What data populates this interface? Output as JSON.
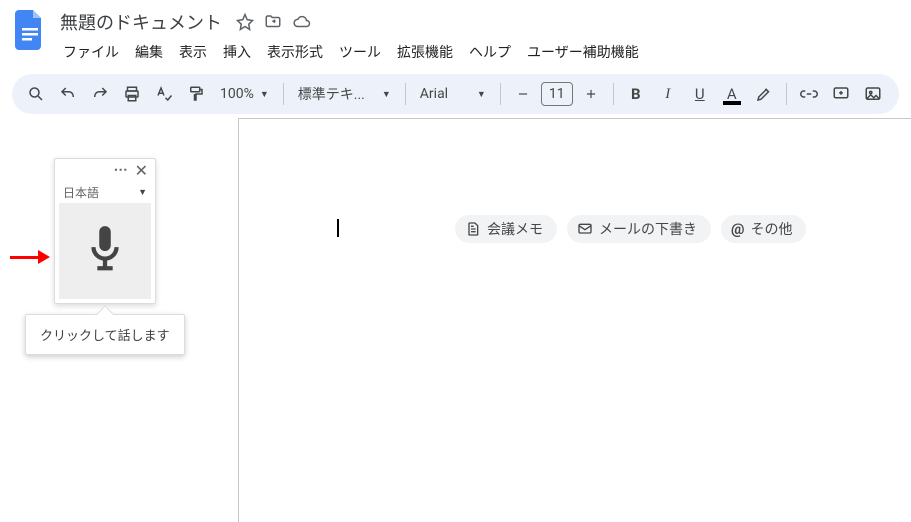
{
  "header": {
    "title": "無題のドキュメント",
    "icons": {
      "star": "star-icon",
      "move": "folder-move-icon",
      "cloud": "cloud-saved-icon"
    }
  },
  "menubar": {
    "items": [
      "ファイル",
      "編集",
      "表示",
      "挿入",
      "表示形式",
      "ツール",
      "拡張機能",
      "ヘルプ",
      "ユーザー補助機能"
    ]
  },
  "toolbar": {
    "zoom": "100%",
    "styles_label": "標準テキ...",
    "font": "Arial",
    "font_size": "11"
  },
  "chips": {
    "meeting": "会議メモ",
    "mail": "メールの下書き",
    "other": "その他"
  },
  "voice": {
    "language": "日本語",
    "tooltip": "クリックして話します"
  }
}
